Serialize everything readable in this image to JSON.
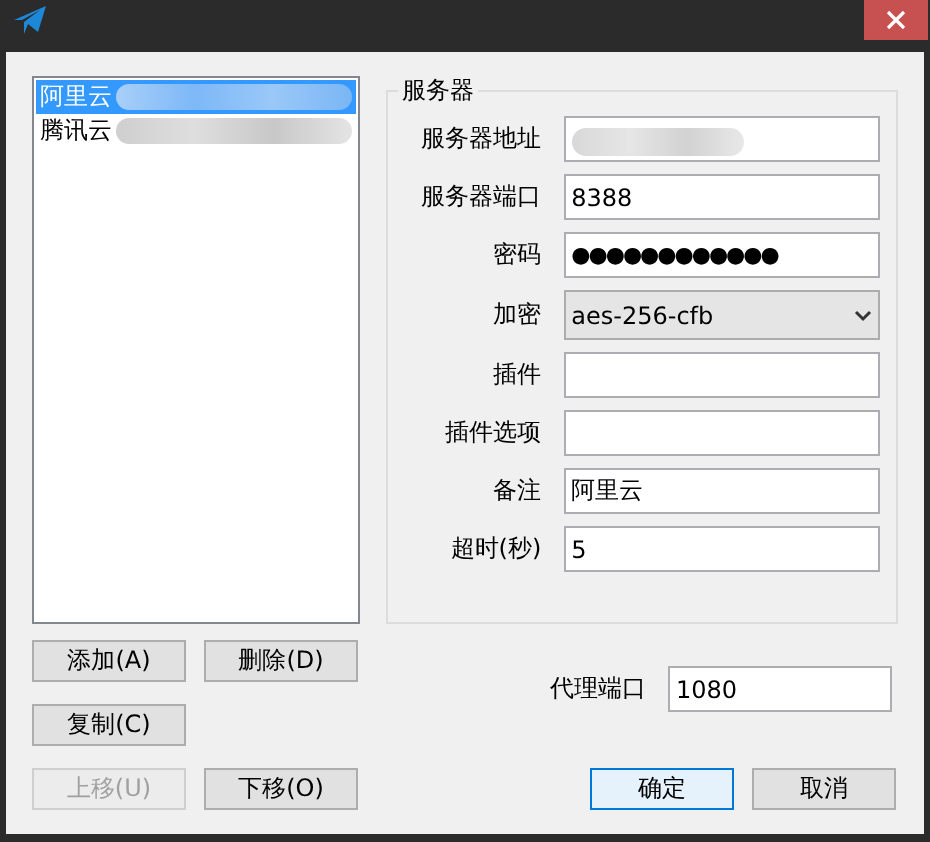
{
  "servers": [
    {
      "label": "阿里云",
      "selected": true,
      "redacted": true
    },
    {
      "label": "腾讯云",
      "selected": false,
      "redacted": true
    }
  ],
  "server_group": {
    "title": "服务器",
    "fields": [
      {
        "label": "服务器地址",
        "kind": "text",
        "redacted": true
      },
      {
        "label": "服务器端口",
        "kind": "text",
        "value": "8388"
      },
      {
        "label": "密码",
        "kind": "password",
        "value": "●●●●●●●●●●●●"
      },
      {
        "label": "加密",
        "kind": "select",
        "value": "aes-256-cfb"
      },
      {
        "label": "插件",
        "kind": "text"
      },
      {
        "label": "插件选项",
        "kind": "text"
      },
      {
        "label": "备注",
        "kind": "text",
        "value": "阿里云"
      },
      {
        "label": "超时(秒)",
        "kind": "text",
        "value": "5"
      }
    ]
  },
  "list_buttons": [
    {
      "label": "添加(A)",
      "disabled": false
    },
    {
      "label": "删除(D)",
      "disabled": false
    },
    {
      "label": "复制(C)",
      "disabled": false
    },
    {
      "label": "上移(U)",
      "disabled": true
    },
    {
      "label": "下移(O)",
      "disabled": false
    }
  ],
  "proxy_port": {
    "label": "代理端口",
    "value": "1080"
  },
  "dialog_buttons": [
    {
      "label": "确定",
      "default": true
    },
    {
      "label": "取消",
      "default": false
    }
  ]
}
